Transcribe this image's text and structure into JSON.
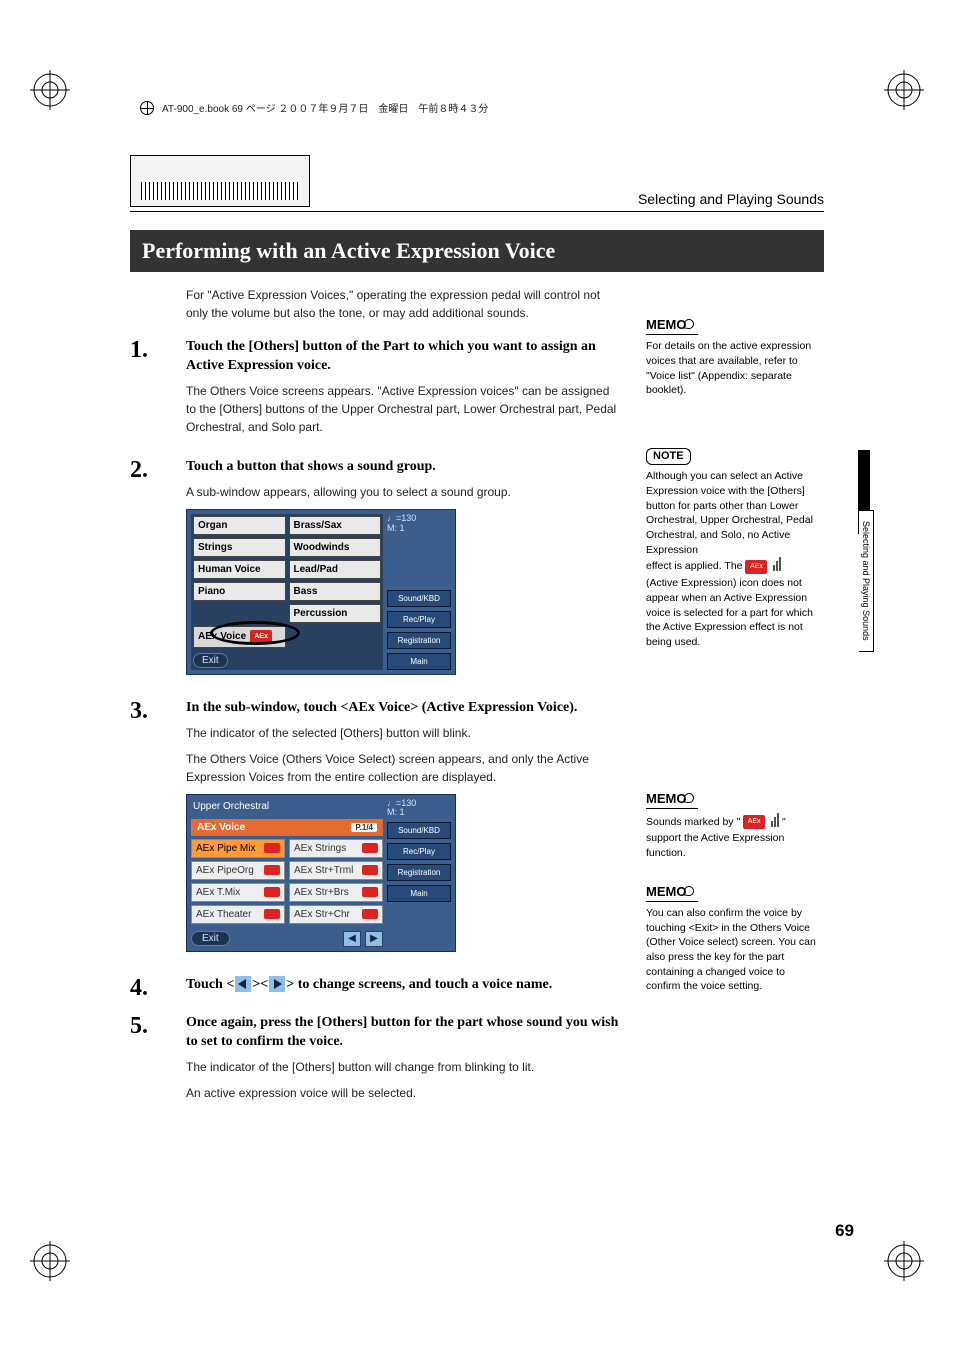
{
  "page_number": "69",
  "file_header": "AT-900_e.book  69 ページ  ２００７年９月７日　金曜日　午前８時４３分",
  "chapter": "Selecting and Playing Sounds",
  "vertical_tab": "Selecting and Playing Sounds",
  "section_title": "Performing with an Active Expression Voice",
  "intro": "For \"Active Expression Voices,\" operating the expression pedal will control not only the volume but also the tone, or may add additional sounds.",
  "steps": {
    "s1": {
      "num": "1.",
      "title": "Touch the [Others] button of the Part to which you want to assign an Active Expression voice.",
      "text": "The Others Voice screens appears. \"Active Expression voices\" can be assigned to the [Others] buttons of the Upper Orchestral part, Lower Orchestral part, Pedal Orchestral, and Solo part."
    },
    "s2": {
      "num": "2.",
      "title": "Touch a button that shows a sound group.",
      "text": "A sub-window appears, allowing you to select a sound group."
    },
    "s3": {
      "num": "3.",
      "title": "In the sub-window, touch <AEx Voice> (Active Expression Voice).",
      "text1": "The indicator of the selected [Others] button will blink.",
      "text2": "The Others Voice (Others Voice Select) screen appears, and only the Active Expression Voices from the entire collection are displayed."
    },
    "s4": {
      "num": "4.",
      "title_pre": "Touch <",
      "title_mid": "><",
      "title_post": "> to change screens, and touch a voice name."
    },
    "s5": {
      "num": "5.",
      "title": "Once again, press the [Others] button for the part whose sound you wish to set to confirm the voice.",
      "text1": "The indicator of the [Others] button will change from blinking to lit.",
      "text2": "An active expression voice will be selected."
    }
  },
  "ui1": {
    "tempo_line1": "♩=130",
    "tempo_line2": "M:    1",
    "cells": [
      "Organ",
      "Brass/Sax",
      "Strings",
      "Woodwinds",
      "Human Voice",
      "Lead/Pad",
      "Piano",
      "Bass",
      "",
      "Percussion"
    ],
    "aex": "AEx Voice",
    "exit": "Exit",
    "side": [
      "Sound/KBD",
      "Rec/Play",
      "Registration",
      "Main"
    ]
  },
  "ui2": {
    "header": "Upper Orchestral",
    "tempo_line1": "♩=130",
    "tempo_line2": "M:    1",
    "tab": "AEx Voice",
    "page": "P.1/4",
    "rows": [
      [
        "AEx Pipe Mix",
        "AEx Strings"
      ],
      [
        "AEx PipeOrg",
        "AEx Str+Trml"
      ],
      [
        "AEx T.Mix",
        "AEx Str+Brs"
      ],
      [
        "AEx Theater",
        "AEx Str+Chr"
      ]
    ],
    "exit": "Exit",
    "side": [
      "Sound/KBD",
      "Rec/Play",
      "Registration",
      "Main"
    ]
  },
  "sidebar": {
    "memo_label": "MEMO",
    "note_label": "NOTE",
    "memo1": "For details on the active expression voices that are available, refer to \"Voice list\" (Appendix: separate booklet).",
    "note1a": "Although you can select an Active Expression voice with the [Others] button for parts other than Lower Orchestral, Upper Orchestral, Pedal Orchestral, and Solo, no Active Expression",
    "note1b": "effect is applied. The ",
    "note1c": " (Active Expression) icon does not appear when an Active Expression voice is selected for a part for which the Active Expression effect is not being used.",
    "memo2a": "Sounds marked by \" ",
    "memo2b": "\" support the Active Expression function.",
    "memo3": "You can also confirm the voice by touching <Exit> in the Others Voice (Other Voice select) screen. You can also press the key for the part containing a changed voice to confirm the voice setting."
  }
}
